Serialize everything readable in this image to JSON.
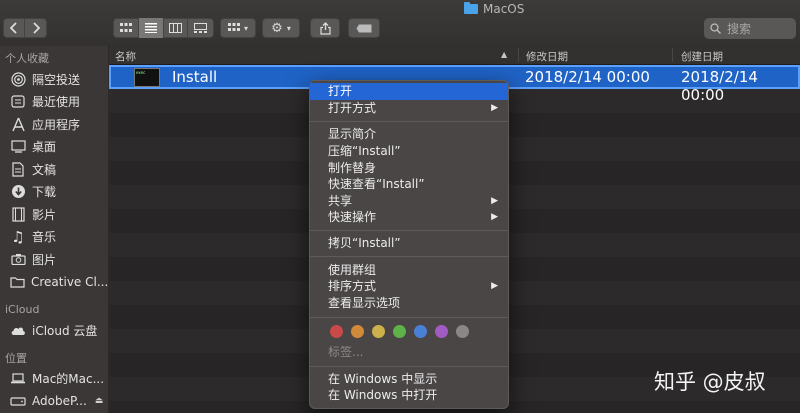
{
  "window": {
    "title": "MacOS"
  },
  "toolbar": {
    "back_icon": "chevron-left",
    "forward_icon": "chevron-right",
    "view_icons": [
      "icon-view",
      "list-view",
      "column-view",
      "gallery-view"
    ],
    "group_icon": "grid-group",
    "action_icon": "gear",
    "share_icon": "share",
    "tag_icon": "tag"
  },
  "search": {
    "placeholder": "搜索"
  },
  "sidebar": {
    "sections": [
      {
        "header": "个人收藏",
        "items": [
          {
            "label": "隔空投送",
            "icon": "airdrop"
          },
          {
            "label": "最近使用",
            "icon": "recents"
          },
          {
            "label": "应用程序",
            "icon": "applications"
          },
          {
            "label": "桌面",
            "icon": "desktop"
          },
          {
            "label": "文稿",
            "icon": "documents"
          },
          {
            "label": "下载",
            "icon": "downloads"
          },
          {
            "label": "影片",
            "icon": "movies"
          },
          {
            "label": "音乐",
            "icon": "music"
          },
          {
            "label": "图片",
            "icon": "pictures"
          },
          {
            "label": "Creative Cl...",
            "icon": "folder"
          }
        ]
      },
      {
        "header": "iCloud",
        "items": [
          {
            "label": "iCloud 云盘",
            "icon": "cloud"
          }
        ]
      },
      {
        "header": "位置",
        "items": [
          {
            "label": "Mac的Mac...",
            "icon": "laptop"
          },
          {
            "label": "AdobeP...",
            "icon": "drive",
            "eject": "⏏"
          }
        ]
      }
    ]
  },
  "columns": {
    "name": "名称",
    "modified": "修改日期",
    "created": "创建日期"
  },
  "file": {
    "name": "Install",
    "modified": "2018/2/14 00:00",
    "created": "2018/2/14 00:00"
  },
  "context_menu": {
    "items": [
      {
        "label": "打开",
        "highlight": true
      },
      {
        "label": "打开方式",
        "submenu": true
      },
      {
        "label": "显示简介"
      },
      {
        "label": "压缩“Install”"
      },
      {
        "label": "制作替身"
      },
      {
        "label": "快速查看“Install”"
      },
      {
        "label": "共享",
        "submenu": true
      },
      {
        "label": "快速操作",
        "submenu": true
      },
      {
        "label": "拷贝“Install”"
      },
      {
        "label": "使用群组"
      },
      {
        "label": "排序方式",
        "submenu": true
      },
      {
        "label": "查看显示选项"
      },
      {
        "label": "标签..."
      },
      {
        "label": "在 Windows 中显示"
      },
      {
        "label": "在 Windows 中打开"
      }
    ],
    "tag_colors": [
      "#c94a4a",
      "#d08a3a",
      "#cdb14a",
      "#5fb24a",
      "#4a7fd6",
      "#a35bc4",
      "#8a8787"
    ]
  },
  "watermark": "知乎 @皮叔"
}
